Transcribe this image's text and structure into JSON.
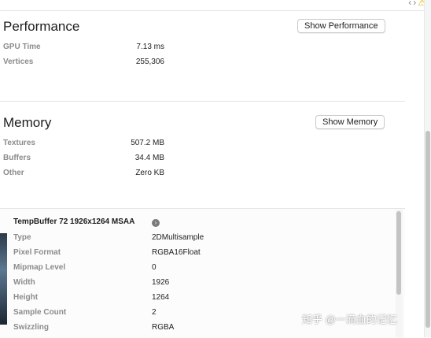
{
  "performance": {
    "title": "Performance",
    "button_label": "Show Performance",
    "rows": [
      {
        "label": "GPU Time",
        "value": "7.13 ms"
      },
      {
        "label": "Vertices",
        "value": "255,306"
      }
    ]
  },
  "memory": {
    "title": "Memory",
    "button_label": "Show Memory",
    "rows": [
      {
        "label": "Textures",
        "value": "507.2 MB"
      },
      {
        "label": "Buffers",
        "value": "34.4 MB"
      },
      {
        "label": "Other",
        "value": "Zero KB"
      }
    ]
  },
  "resource": {
    "title": "TempBuffer 72 1926x1264 MSAA",
    "goto_icon": "arrow-circle-right-icon",
    "rows": [
      {
        "label": "Type",
        "value": "2DMultisample"
      },
      {
        "label": "Pixel Format",
        "value": "RGBA16Float"
      },
      {
        "label": "Mipmap Level",
        "value": "0"
      },
      {
        "label": "Width",
        "value": "1926"
      },
      {
        "label": "Height",
        "value": "1264"
      },
      {
        "label": "Sample Count",
        "value": "2"
      },
      {
        "label": "Swizzling",
        "value": "RGBA"
      }
    ]
  },
  "top_icons": [
    "chevron-left-icon",
    "chevron-right-icon",
    "warning-icon"
  ],
  "watermark": "知乎 @一滴血的记忆",
  "colors": {
    "label_gray": "#8b8b8b",
    "warning": "#e8b400",
    "separator": "#e3e3e3"
  }
}
